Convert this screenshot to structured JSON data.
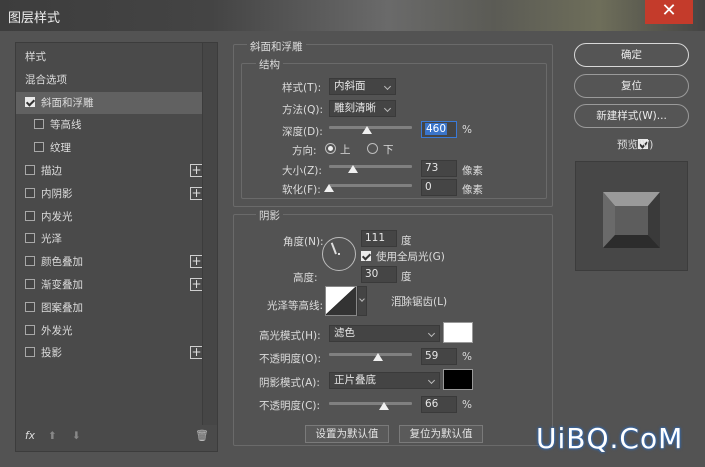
{
  "window": {
    "title": "图层样式",
    "close": "✕"
  },
  "left": {
    "items": [
      {
        "label": "样式",
        "cb": null,
        "plus": false,
        "sel": false,
        "indent": false
      },
      {
        "label": "混合选项",
        "cb": null,
        "plus": false,
        "sel": false,
        "indent": false
      },
      {
        "label": "斜面和浮雕",
        "cb": true,
        "plus": false,
        "sel": true,
        "indent": false
      },
      {
        "label": "等高线",
        "cb": false,
        "plus": false,
        "sel": false,
        "indent": true
      },
      {
        "label": "纹理",
        "cb": false,
        "plus": false,
        "sel": false,
        "indent": true
      },
      {
        "label": "描边",
        "cb": false,
        "plus": true,
        "sel": false,
        "indent": false
      },
      {
        "label": "内阴影",
        "cb": false,
        "plus": true,
        "sel": false,
        "indent": false
      },
      {
        "label": "内发光",
        "cb": false,
        "plus": false,
        "sel": false,
        "indent": false
      },
      {
        "label": "光泽",
        "cb": false,
        "plus": false,
        "sel": false,
        "indent": false
      },
      {
        "label": "颜色叠加",
        "cb": false,
        "plus": true,
        "sel": false,
        "indent": false
      },
      {
        "label": "渐变叠加",
        "cb": false,
        "plus": true,
        "sel": false,
        "indent": false
      },
      {
        "label": "图案叠加",
        "cb": false,
        "plus": false,
        "sel": false,
        "indent": false
      },
      {
        "label": "外发光",
        "cb": false,
        "plus": false,
        "sel": false,
        "indent": false
      },
      {
        "label": "投影",
        "cb": false,
        "plus": true,
        "sel": false,
        "indent": false
      }
    ],
    "footer": {
      "fx": "fx",
      "up": "⬆",
      "down": "⬇",
      "trash": "🗑"
    }
  },
  "bevel": {
    "title": "斜面和浮雕",
    "structure": "结构",
    "style_label": "样式(T):",
    "style_value": "内斜面",
    "method_label": "方法(Q):",
    "method_value": "雕刻清晰",
    "depth_label": "深度(D):",
    "depth_value": "460",
    "depth_unit": "%",
    "depth_level": 0.46,
    "dir_label": "方向:",
    "dir_up": "上",
    "dir_down": "下",
    "size_label": "大小(Z):",
    "size_value": "73",
    "size_unit": "像素",
    "size_level": 0.29,
    "soften_label": "软化(F):",
    "soften_value": "0",
    "soften_unit": "像素",
    "soften_level": 0
  },
  "shading": {
    "title": "阴影",
    "angle_label": "角度(N):",
    "angle_value": "111",
    "angle_unit": "度",
    "global_label": "使用全局光(G)",
    "altitude_label": "高度:",
    "altitude_value": "30",
    "altitude_unit": "度",
    "gloss_label": "光泽等高线:",
    "antialias_label": "消除锯齿(L)",
    "hl_mode_label": "高光模式(H):",
    "hl_mode_value": "滤色",
    "hl_color": "#ffffff",
    "hl_opacity_label": "不透明度(O):",
    "hl_opacity_value": "59",
    "hl_opacity_unit": "%",
    "hl_level": 0.59,
    "sh_mode_label": "阴影模式(A):",
    "sh_mode_value": "正片叠底",
    "sh_color": "#000000",
    "sh_opacity_label": "不透明度(C):",
    "sh_opacity_value": "66",
    "sh_opacity_unit": "%",
    "sh_level": 0.66
  },
  "buttons": {
    "set_default": "设置为默认值",
    "reset_default": "复位为默认值",
    "ok": "确定",
    "reset": "复位",
    "new_style": "新建样式(W)...",
    "preview": "预览(V)"
  },
  "watermark": "UiBQ.CoM"
}
